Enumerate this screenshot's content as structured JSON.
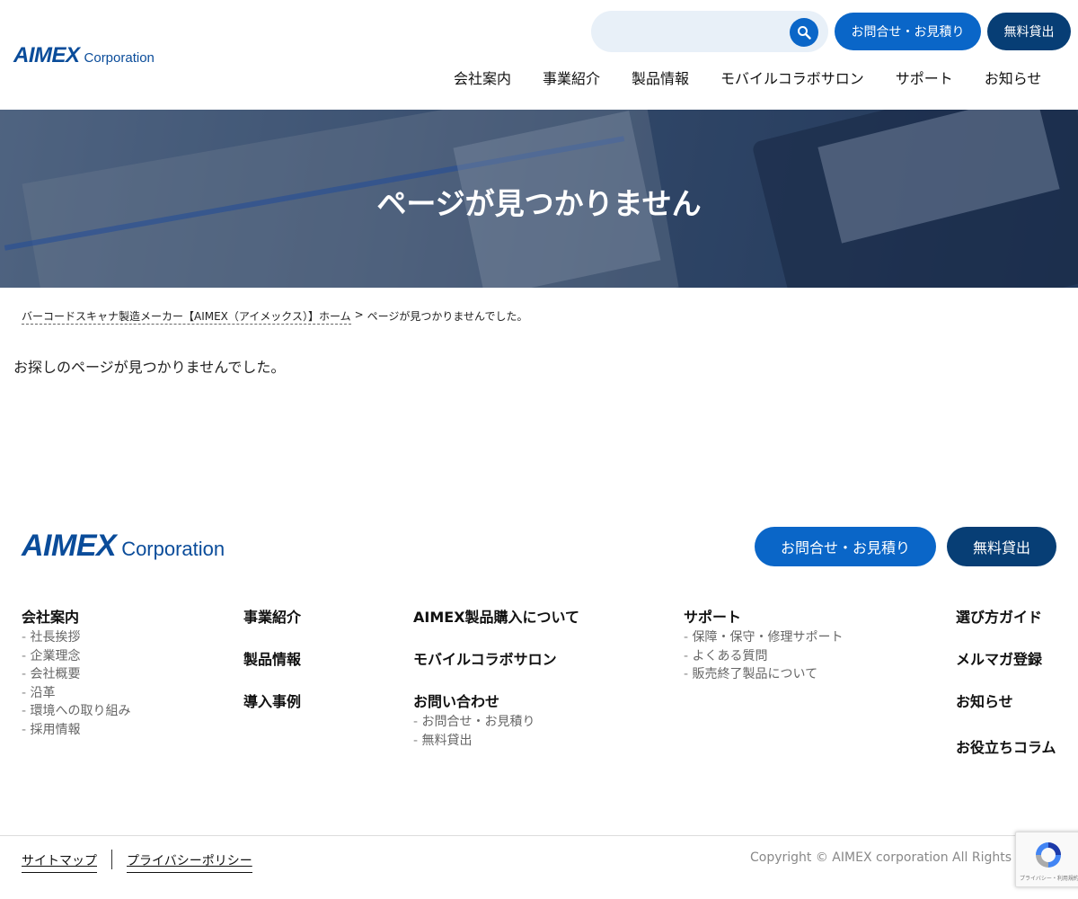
{
  "header": {
    "logo_mark": "AIMEX",
    "logo_corp": "Corporation",
    "search_placeholder": "",
    "contact_button": "お問合せ・お見積り",
    "loan_button": "無料貸出",
    "nav": [
      "会社案内",
      "事業紹介",
      "製品情報",
      "モバイルコラボサロン",
      "サポート",
      "お知らせ"
    ]
  },
  "hero": {
    "title": "ページが見つかりません"
  },
  "breadcrumb": {
    "home": "バーコードスキャナ製造メーカー【AIMEX（アイメックス）】ホーム",
    "separator": ">",
    "current": "ページが見つかりませんでした。"
  },
  "content": {
    "message": "お探しのページが見つかりませんでした。"
  },
  "footer": {
    "logo_mark": "AIMEX",
    "logo_corp": "Corporation",
    "contact_button": "お問合せ・お見積り",
    "loan_button": "無料貸出",
    "col1": {
      "head": "会社案内",
      "items": [
        "社長挨拶",
        "企業理念",
        "会社概要",
        "沿革",
        "環境への取り組み",
        "採用情報"
      ]
    },
    "col2": {
      "heads": [
        "事業紹介",
        "製品情報",
        "導入事例"
      ]
    },
    "col3": {
      "head1": "AIMEX製品購入について",
      "head2": "モバイルコラボサロン",
      "head3": "お問い合わせ",
      "items": [
        "お問合せ・お見積り",
        "無料貸出"
      ]
    },
    "col4": {
      "head": "サポート",
      "items": [
        "保障・保守・修理サポート",
        "よくある質問",
        "販売終了製品について"
      ]
    },
    "col5": {
      "heads": [
        "選び方ガイド",
        "メルマガ登録",
        "お知らせ",
        "お役立ちコラム"
      ]
    },
    "sitemap": "サイトマップ",
    "privacy": "プライバシーポリシー",
    "copyright": "Copyright © AIMEX corporation All Rights Reserved.",
    "recaptcha_text": "プライバシー・利用規約"
  },
  "colors": {
    "primary": "#0a66c8",
    "dark": "#073e75",
    "brand": "#0a4c9a"
  }
}
